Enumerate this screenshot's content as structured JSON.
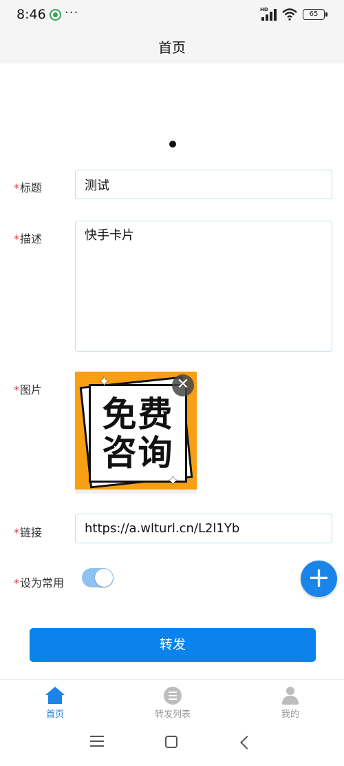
{
  "status_bar": {
    "time": "8:46",
    "more": "···",
    "signal_label": "HD",
    "battery": "65"
  },
  "nav": {
    "title": "首页"
  },
  "form": {
    "required_mark": "*",
    "title_label": "标题",
    "title_value": "测试",
    "desc_label": "描述",
    "desc_value": "快手卡片",
    "image_label": "图片",
    "image_text_line1": "免费",
    "image_text_line2": "咨询",
    "link_label": "链接",
    "link_value": "https://a.wlturl.cn/L2l1Yb",
    "favorite_label": "设为常用",
    "favorite_on": true
  },
  "actions": {
    "submit_label": "转发",
    "fab_symbol": "+",
    "remove_symbol": "✕"
  },
  "tabs": [
    {
      "label": "首页",
      "icon": "home-icon",
      "active": true
    },
    {
      "label": "转发列表",
      "icon": "list-icon",
      "active": false
    },
    {
      "label": "我的",
      "icon": "person-icon",
      "active": false
    }
  ],
  "colors": {
    "accent": "#1a84e9",
    "required": "#e03030",
    "tab_inactive": "#999999",
    "image_bg": "#f99f13"
  }
}
